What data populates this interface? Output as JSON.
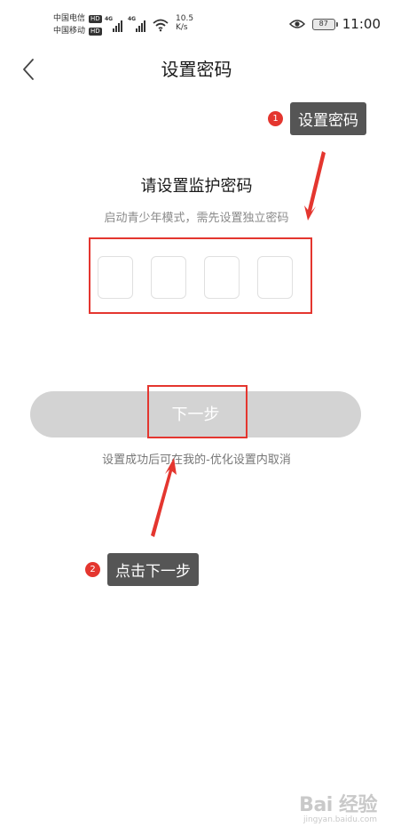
{
  "status_bar": {
    "carrier_1": "中国电信",
    "carrier_2": "中国移动",
    "hd_badge": "HD",
    "network_tag": "4G",
    "net_speed_value": "10.5",
    "net_speed_unit": "K/s",
    "battery": "87",
    "time": "11:00",
    "icons": [
      "signal-icon",
      "wifi-icon",
      "eye-icon",
      "battery-icon"
    ]
  },
  "header": {
    "title": "设置密码",
    "back_icon": "chevron-left-icon"
  },
  "main": {
    "heading": "请设置监护密码",
    "subheading": "启动青少年模式，需先设置独立密码",
    "pin_length": 4,
    "next_button": "下一步",
    "hint": "设置成功后可在我的-优化设置内取消"
  },
  "annotations": [
    {
      "number": "1",
      "label": "设置密码"
    },
    {
      "number": "2",
      "label": "点击下一步"
    }
  ],
  "watermark": {
    "logo": "Bai 经验",
    "url": "jingyan.baidu.com"
  },
  "colors": {
    "highlight": "#e4362f",
    "button_disabled": "#d3d3d3",
    "callout_bg": "#555555"
  }
}
